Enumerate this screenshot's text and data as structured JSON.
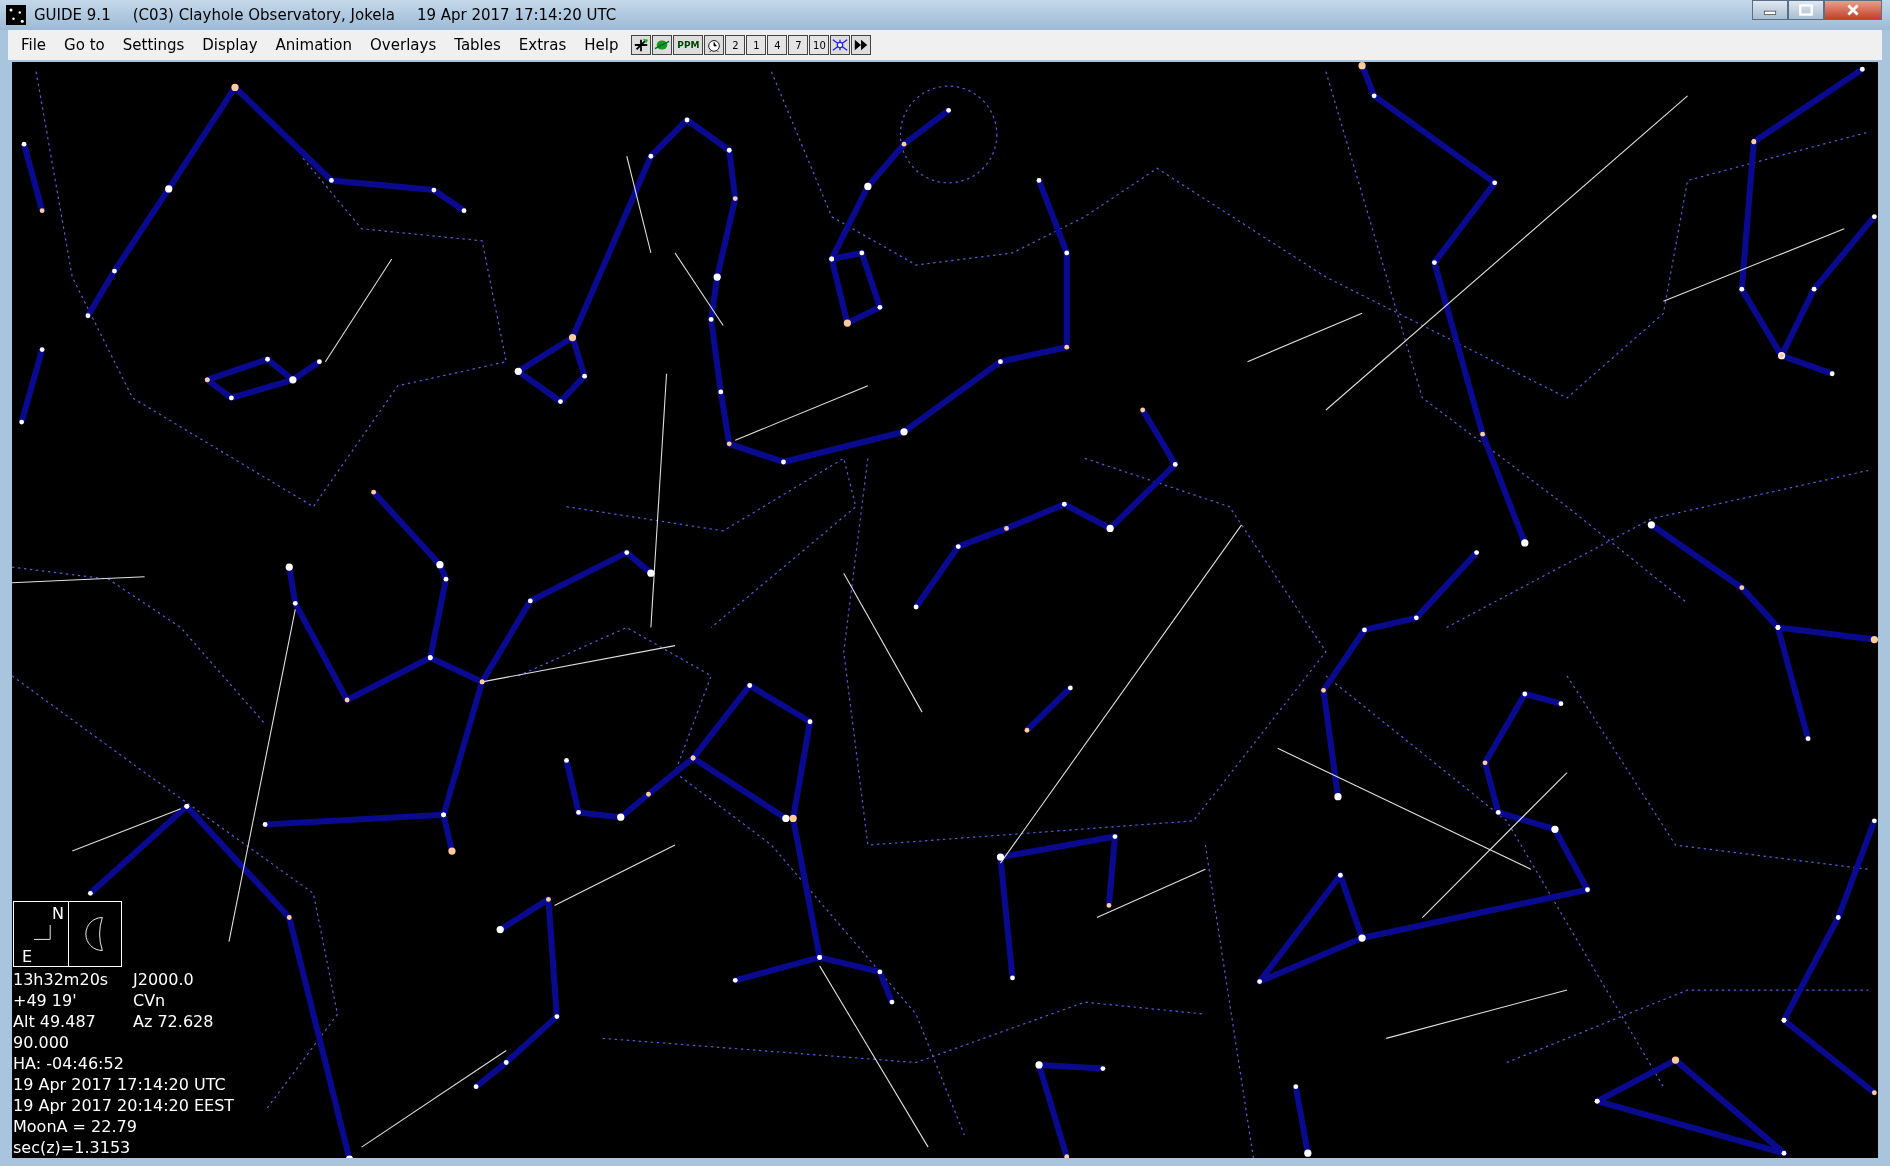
{
  "window": {
    "title": [
      "GUIDE 9.1",
      "(C03) Clayhole Observatory, Jokela",
      "19 Apr 2017 17:14:20 UTC"
    ]
  },
  "menu": [
    "File",
    "Go to",
    "Settings",
    "Display",
    "Animation",
    "Overlays",
    "Tables",
    "Extras",
    "Help"
  ],
  "toolbar": [
    {
      "kind": "chart"
    },
    {
      "kind": "planet"
    },
    {
      "kind": "text",
      "label": "PPM"
    },
    {
      "kind": "clock"
    },
    {
      "kind": "zoom",
      "label": "2"
    },
    {
      "kind": "zoom",
      "label": "1"
    },
    {
      "kind": "zoom",
      "label": "4"
    },
    {
      "kind": "zoom",
      "label": "7"
    },
    {
      "kind": "zoom",
      "label": "10"
    },
    {
      "kind": "grid"
    },
    {
      "kind": "forward"
    }
  ],
  "compass": {
    "north": "N",
    "east": "E"
  },
  "info": [
    [
      "13h32m20s",
      "J2000.0"
    ],
    [
      "+49 19'",
      "CVn"
    ],
    [
      "Alt 49.487",
      "Az 72.628"
    ],
    [
      "90.000"
    ],
    [
      "HA: -04:46:52"
    ],
    [
      "19 Apr 2017 17:14:20 UTC"
    ],
    [
      "19 Apr 2017 20:14:20 EEST"
    ],
    [
      "MoonA = 22.79"
    ],
    [
      "sec(z)=1.3153"
    ]
  ]
}
